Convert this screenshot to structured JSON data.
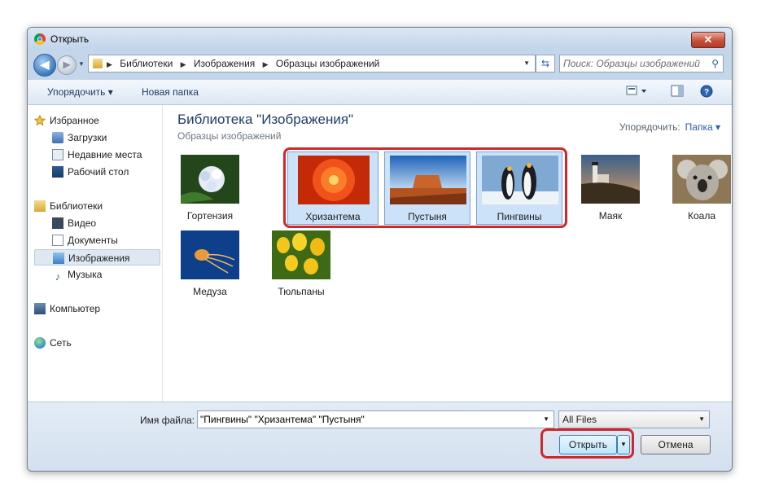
{
  "window": {
    "title": "Открыть",
    "close_label": "✕"
  },
  "nav": {
    "back_label": "◀",
    "forward_label": "▶",
    "breadcrumbs": [
      "Библиотеки",
      "Изображения",
      "Образцы изображений"
    ],
    "crumb_separator": "▶",
    "search_placeholder": "Поиск: Образцы изображений"
  },
  "toolbar": {
    "organize_label": "Упорядочить ▾",
    "new_folder_label": "Новая папка",
    "help_label": "?"
  },
  "sidebar": {
    "favorites": {
      "label": "Избранное",
      "items": [
        "Загрузки",
        "Недавние места",
        "Рабочий стол"
      ]
    },
    "libraries": {
      "label": "Библиотеки",
      "items": [
        "Видео",
        "Документы",
        "Изображения",
        "Музыка"
      ]
    },
    "computer_label": "Компьютер",
    "network_label": "Сеть"
  },
  "library": {
    "title": "Библиотека \"Изображения\"",
    "subtitle": "Образцы изображений",
    "arrange_label": "Упорядочить:",
    "arrange_value": "Папка ▾"
  },
  "files": [
    {
      "name": "Гортензия",
      "selected": false
    },
    {
      "name": "Хризантема",
      "selected": true
    },
    {
      "name": "Пустыня",
      "selected": true
    },
    {
      "name": "Пингвины",
      "selected": true
    },
    {
      "name": "Маяк",
      "selected": false
    },
    {
      "name": "Коала",
      "selected": false
    },
    {
      "name": "Медуза",
      "selected": false
    },
    {
      "name": "Тюльпаны",
      "selected": false
    }
  ],
  "footer": {
    "filename_label": "Имя файла:",
    "filename_value": "\"Пингвины\" \"Хризантема\" \"Пустыня\"",
    "filter_value": "All Files",
    "open_label": "Открыть",
    "cancel_label": "Отмена"
  },
  "colors": {
    "callout": "#d3262b",
    "selection": "#cce2f8",
    "link": "#2a5ea8"
  }
}
